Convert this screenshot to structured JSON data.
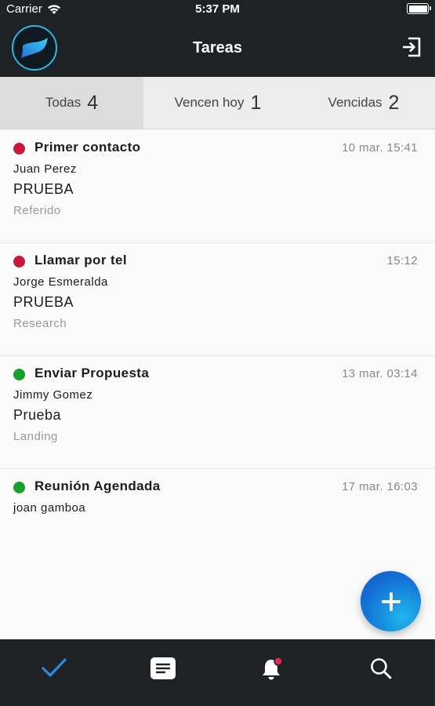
{
  "status_bar": {
    "carrier": "Carrier",
    "time": "5:37 PM"
  },
  "navbar": {
    "title": "Tareas",
    "logo_icon": "brand-logo",
    "logout_icon": "logout-icon"
  },
  "tabs": [
    {
      "label": "Todas",
      "count": "4",
      "selected": true
    },
    {
      "label": "Vencen hoy",
      "count": "1",
      "selected": false
    },
    {
      "label": "Vencidas",
      "count": "2",
      "selected": false
    }
  ],
  "tasks": [
    {
      "title": "Primer contacto",
      "time": "10 mar. 15:41",
      "contact": "Juan Perez",
      "description": "PRUEBA",
      "source": "Referido",
      "status_color": "#c8183c"
    },
    {
      "title": "Llamar por tel",
      "time": "15:12",
      "contact": "Jorge Esmeralda",
      "description": "PRUEBA",
      "source": "Research",
      "status_color": "#c8183c"
    },
    {
      "title": "Enviar Propuesta",
      "time": "13 mar. 03:14",
      "contact": "Jimmy Gomez",
      "description": "Prueba",
      "source": "Landing",
      "status_color": "#16a02e"
    },
    {
      "title": "Reunión Agendada",
      "time": "17 mar. 16:03",
      "contact": "joan gamboa",
      "description": "",
      "source": "",
      "status_color": "#16a02e"
    }
  ],
  "fab": {
    "icon": "plus-icon"
  },
  "tabbar": [
    {
      "icon": "checkmark-icon",
      "active": true
    },
    {
      "icon": "notes-icon",
      "active": false
    },
    {
      "icon": "bell-icon",
      "active": false,
      "has_notification": true
    },
    {
      "icon": "search-icon",
      "active": false
    }
  ],
  "colors": {
    "accent": "#2b8fe0",
    "header_bg": "#1f2225",
    "notification_dot": "#e0245e"
  }
}
